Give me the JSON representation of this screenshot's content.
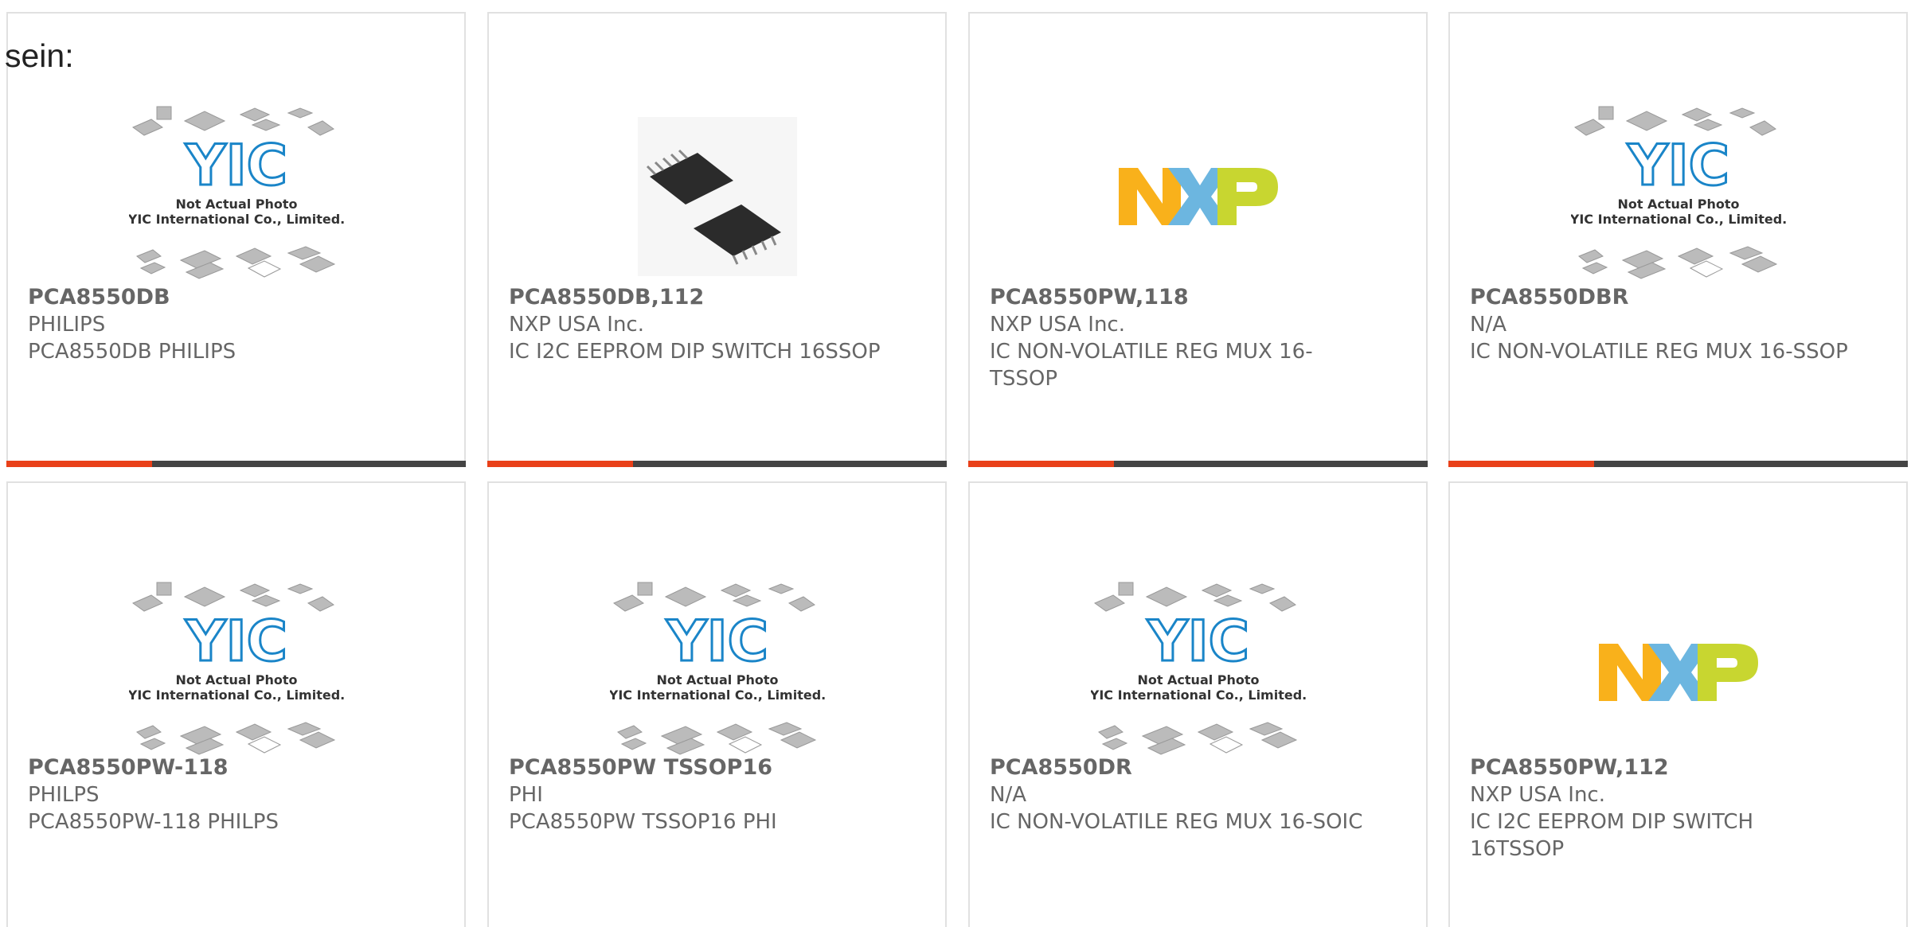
{
  "intro_text": "sein:",
  "placeholder_image": {
    "line1": "Not Actual Photo",
    "line2": "YIC International Co., Limited.",
    "logo_text": "YIC"
  },
  "nxp_logo": {
    "icon": "nxp-logo",
    "colors": {
      "n": "#f9b11b",
      "x": "#6cb6e0",
      "p": "#c8d630"
    }
  },
  "colors": {
    "accent": "#e94019",
    "bar": "#444444",
    "border": "#e1e1e1",
    "text": "#666666"
  },
  "products": [
    {
      "part": "PCA8550DB",
      "maker": "PHILIPS",
      "desc": "PCA8550DB PHILIPS",
      "image": "placeholder"
    },
    {
      "part": "PCA8550DB,112",
      "maker": "NXP USA Inc.",
      "desc": "IC I2C EEPROM DIP SWITCH 16SSOP",
      "image": "ssop-chip"
    },
    {
      "part": "PCA8550PW,118",
      "maker": "NXP USA Inc.",
      "desc": "IC NON-VOLATILE REG MUX 16-TSSOP",
      "image": "nxp-logo"
    },
    {
      "part": "PCA8550DBR",
      "maker": "N/A",
      "desc": "IC NON-VOLATILE REG MUX 16-SSOP",
      "image": "placeholder"
    },
    {
      "part": "PCA8550PW-118",
      "maker": "PHILPS",
      "desc": "PCA8550PW-118 PHILPS",
      "image": "placeholder"
    },
    {
      "part": "PCA8550PW TSSOP16",
      "maker": "PHI",
      "desc": "PCA8550PW TSSOP16 PHI",
      "image": "placeholder"
    },
    {
      "part": "PCA8550DR",
      "maker": "N/A",
      "desc": "IC NON-VOLATILE REG MUX 16-SOIC",
      "image": "placeholder"
    },
    {
      "part": "PCA8550PW,112",
      "maker": "NXP USA Inc.",
      "desc": "IC I2C EEPROM DIP SWITCH 16TSSOP",
      "image": "nxp-logo"
    }
  ]
}
